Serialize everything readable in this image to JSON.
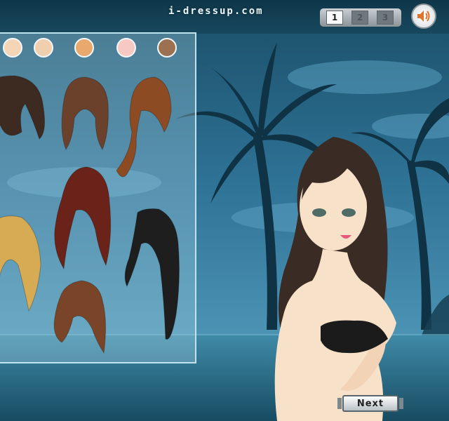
{
  "site": {
    "logo_text": "i-dressup.com"
  },
  "page_nav": {
    "pages": [
      "1",
      "2",
      "3"
    ],
    "active_index": 0
  },
  "sound": {
    "icon": "speaker-icon",
    "state": "on"
  },
  "panel": {
    "skin_tones": [
      "#f4d5b6",
      "#efcfae",
      "#e9a86c",
      "#f8c9c3",
      "#9c7152"
    ],
    "hairstyles": [
      {
        "name": "dark-brown-wavy",
        "color": "#3d2a21"
      },
      {
        "name": "medium-brown-bob",
        "color": "#6c412b"
      },
      {
        "name": "auburn-braid",
        "color": "#8c4b23"
      },
      {
        "name": "burgundy-curly",
        "color": "#6b2219"
      },
      {
        "name": "blonde-wavy",
        "color": "#d7aa54"
      },
      {
        "name": "black-straight",
        "color": "#1e1e1f"
      },
      {
        "name": "chestnut-curls",
        "color": "#7a4428"
      }
    ]
  },
  "character": {
    "hair_color": "#3a2b24",
    "skin_color": "#f7e1c8",
    "top_color": "#1b1b1b"
  },
  "buttons": {
    "next_label": "Next"
  }
}
